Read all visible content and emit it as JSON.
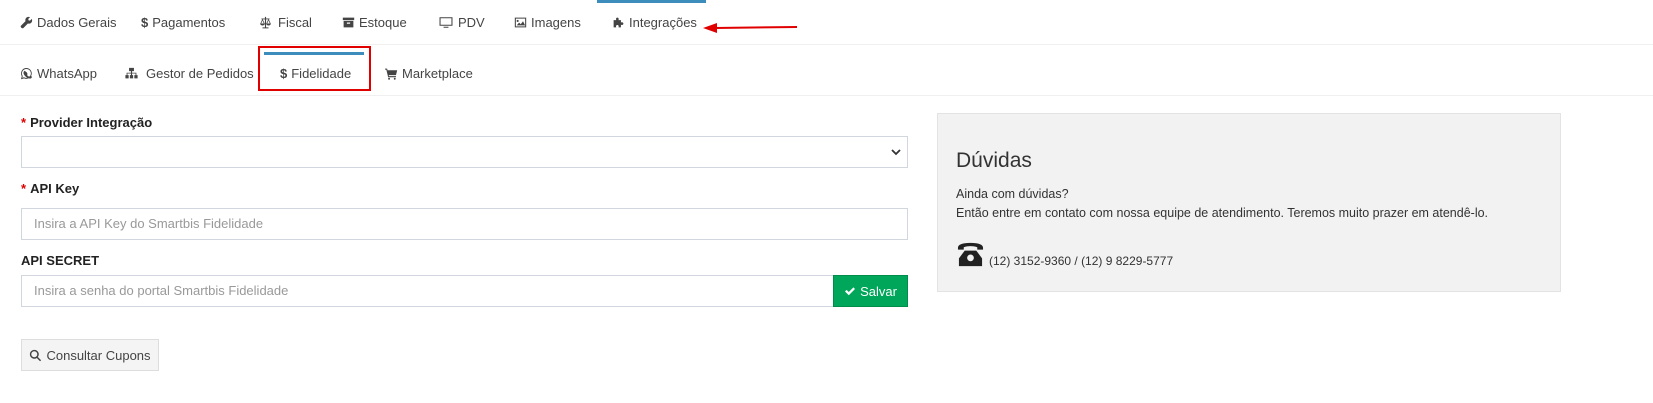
{
  "main_tabs": [
    {
      "label": "Dados Gerais",
      "icon": "wrench-icon"
    },
    {
      "label": "Pagamentos",
      "icon": "dollar-icon"
    },
    {
      "label": "Fiscal",
      "icon": "balance-scale-icon"
    },
    {
      "label": "Estoque",
      "icon": "archive-icon"
    },
    {
      "label": "PDV",
      "icon": "monitor-icon"
    },
    {
      "label": "Imagens",
      "icon": "image-icon"
    },
    {
      "label": "Integrações",
      "icon": "puzzle-icon",
      "active": true
    }
  ],
  "sub_tabs": [
    {
      "label": "WhatsApp",
      "icon": "whatsapp-icon"
    },
    {
      "label": "Gestor de Pedidos",
      "icon": "sitemap-icon"
    },
    {
      "label": "Fidelidade",
      "icon": "dollar-icon",
      "active": true
    },
    {
      "label": "Marketplace",
      "icon": "cart-icon"
    }
  ],
  "form": {
    "provider": {
      "required_mark": "*",
      "label": "Provider Integração",
      "value": ""
    },
    "api_key": {
      "required_mark": "*",
      "label": "API Key",
      "placeholder": "Insira a API Key do Smartbis Fidelidade"
    },
    "api_secret": {
      "label": "API SECRET",
      "placeholder": "Insira a senha do portal Smartbis Fidelidade"
    },
    "save_label": "Salvar",
    "coupons_label": "Consultar Cupons"
  },
  "help": {
    "title": "Dúvidas",
    "line1": "Ainda com dúvidas?",
    "line2": "Então entre em contato com nossa equipe de atendimento. Teremos muito prazer em atendê-lo.",
    "phone": "(12) 3152-9360 / (12) 9 8229-5777"
  },
  "colors": {
    "active_tab_accent": "#3c8dbc",
    "annotation_red": "#e00000",
    "save_green": "#00a65a"
  }
}
